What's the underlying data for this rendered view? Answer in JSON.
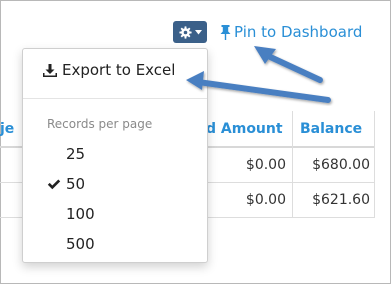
{
  "toolbar": {
    "gear_icon": "gear-icon",
    "pin_label": "Pin to Dashboard"
  },
  "table": {
    "headers": {
      "partial_left": "je",
      "amount": "d Amount",
      "balance": "Balance"
    },
    "rows": [
      {
        "amount": "$0.00",
        "balance": "$680.00"
      },
      {
        "amount": "$0.00",
        "balance": "$621.60"
      }
    ]
  },
  "menu": {
    "export_label": "Export to Excel",
    "records_header": "Records per page",
    "options": [
      {
        "label": "25",
        "selected": false
      },
      {
        "label": "50",
        "selected": true
      },
      {
        "label": "100",
        "selected": false
      },
      {
        "label": "500",
        "selected": false
      }
    ]
  },
  "colors": {
    "accent": "#2a8fd6",
    "button": "#3b6089",
    "arrow": "#4a7fc1"
  }
}
